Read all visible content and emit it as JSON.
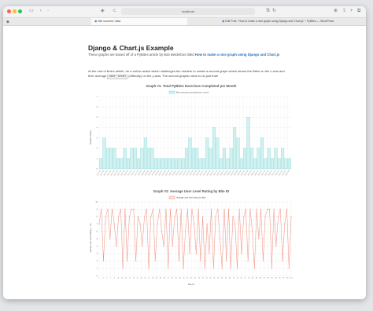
{
  "browser": {
    "address": "localhost",
    "tabs": [
      {
        "label": "Site sources / data"
      },
      {
        "label": "Edit Post: \"How to make a nice graph using Django and Chart.js\" ‹ PyBites — WordPress"
      }
    ]
  },
  "page": {
    "title": "Django & Chart.js Example",
    "subtitle_prefix": "These graphs are based off of a PyBites article by Bob Belderbos titled",
    "subtitle_link": "How to make a nice graph using Django and Chart.js",
    "para_part1": "At the end of Bob's article, he a call-to-action which challenges the readers to create a second graph which shows the Bites on the x-axis and their average",
    "para_code": "user_level",
    "para_part2": "(difficulty) on the y-axis. The second graphic aims to do just that!"
  },
  "colors": {
    "bar_fill": "#d2f2f2",
    "bar_stroke": "#7fd3d3",
    "line_stroke": "#f08c7c",
    "grid": "#ececec"
  },
  "chart_data": [
    {
      "type": "bar",
      "title": "Graph #1: Total PyBites Exercises Completed per Month",
      "legend": "Bite exercises completed per month",
      "ylabel": "Number of Bites",
      "xlabel": "",
      "ylim": [
        0,
        7
      ],
      "yticks": [
        0,
        1,
        2,
        3,
        4,
        5,
        6,
        7
      ],
      "categories": [
        "2017-01",
        "2017-02",
        "2017-03",
        "2017-04",
        "2017-05",
        "2017-06",
        "2017-07",
        "2017-08",
        "2017-09",
        "2017-10",
        "2017-11",
        "2017-12",
        "2018-01",
        "2018-02",
        "2018-03",
        "2018-04",
        "2018-05",
        "2018-06",
        "2018-07",
        "2018-08",
        "2018-09",
        "2018-10",
        "2018-11",
        "2018-12",
        "2019-01",
        "2019-02",
        "2019-03",
        "2019-04",
        "2019-05",
        "2019-06",
        "2019-07",
        "2019-08",
        "2019-09",
        "2019-10",
        "2019-11",
        "2019-12",
        "2020-01",
        "2020-02",
        "2020-03",
        "2020-04",
        "2020-05",
        "2020-06",
        "2020-07",
        "2020-08",
        "2020-09",
        "2020-10",
        "2020-11",
        "2020-12",
        "2021-01",
        "2021-02",
        "2021-03",
        "2021-04",
        "2021-05",
        "2021-06",
        "2021-07",
        "2021-08"
      ],
      "values": [
        1,
        3,
        2,
        2,
        2,
        1,
        1,
        2,
        1,
        2,
        2,
        1,
        2,
        3,
        2,
        2,
        1,
        1,
        1,
        1,
        1,
        1,
        1,
        1,
        1,
        2,
        3,
        2,
        2,
        1,
        1,
        3,
        2,
        4,
        3,
        1,
        2,
        1,
        2,
        4,
        3,
        1,
        2,
        5,
        2,
        1,
        2,
        3,
        1,
        2,
        1,
        2,
        1,
        2,
        1,
        1
      ]
    },
    {
      "type": "line",
      "title": "Graph #2: Average User Level Rating by Bite ID",
      "legend": "Average user level rating by Bite",
      "ylabel": "Average User Level Rating (1 - 10)",
      "xlabel": "Bite ID",
      "ylim": [
        0,
        10
      ],
      "yticks": [
        0,
        1,
        2,
        3,
        4,
        5,
        6,
        7,
        8,
        9,
        10
      ],
      "x": [
        1,
        3,
        5,
        7,
        9,
        11,
        13,
        15,
        17,
        19,
        21,
        23,
        25,
        27,
        29,
        31,
        33,
        35,
        37,
        39,
        41,
        43,
        45,
        47,
        49,
        51,
        53,
        55,
        57,
        59,
        61,
        63,
        65,
        67,
        69,
        71,
        73,
        75,
        77,
        79,
        81,
        83,
        85,
        87,
        89,
        91,
        93,
        95,
        97,
        99,
        101
      ],
      "values": [
        7,
        9,
        2,
        8,
        9,
        5,
        9,
        7,
        4,
        8,
        9,
        1,
        9,
        2,
        8,
        9,
        9,
        2,
        8,
        7,
        4,
        8,
        9,
        1,
        8,
        9,
        2,
        7,
        9,
        6,
        4,
        9,
        1,
        9,
        4,
        8,
        9,
        2,
        9,
        1,
        6,
        9,
        3,
        9,
        7,
        3,
        9,
        2,
        8,
        1,
        7,
        3,
        9,
        1,
        8,
        9,
        5,
        1,
        9,
        2,
        9,
        1,
        8,
        7,
        1,
        9,
        3,
        8,
        9,
        2,
        9,
        6,
        1,
        9,
        5,
        9,
        2,
        8,
        9,
        9,
        1,
        9,
        4,
        8,
        9,
        2,
        7,
        9,
        1,
        8
      ]
    }
  ]
}
